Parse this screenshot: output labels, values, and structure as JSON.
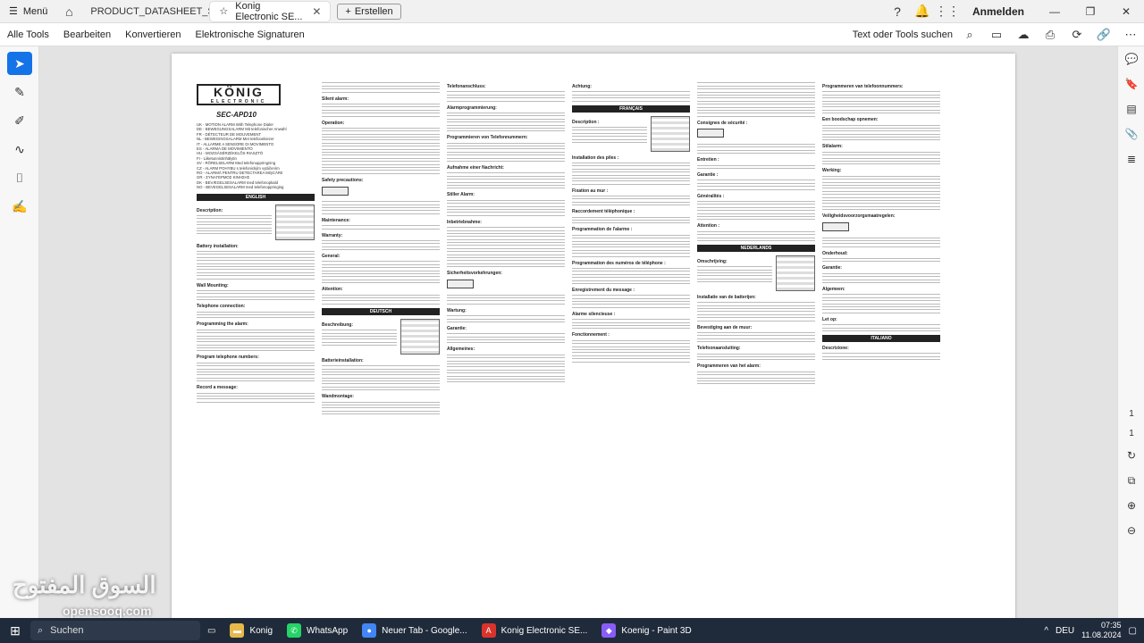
{
  "browser": {
    "menu_label": "Menü",
    "tabs": [
      {
        "title": "PRODUCT_DATASHEET_S...",
        "active": false
      },
      {
        "title": "Konig Electronic SE...",
        "active": true
      }
    ],
    "new_tab_label": "Erstellen",
    "signin_label": "Anmelden"
  },
  "toolbar": {
    "menu": [
      "Alle Tools",
      "Bearbeiten",
      "Konvertieren",
      "Elektronische Signaturen"
    ],
    "search_label": "Text oder Tools suchen"
  },
  "document": {
    "logo": "KÖNIG",
    "logo_sub": "ELECTRONIC",
    "model": "SEC-APD10",
    "sections": [
      "ENGLISH",
      "DEUTSCH",
      "FRANÇAIS",
      "NEDERLANDS",
      "ITALIANO"
    ],
    "col1_lines": [
      "UK - MOTION ALARM With Telephone Dialer",
      "DE - BEWEGUNGSALARM Mit telefonischer Anwahl",
      "FR - DÉTECTEUR DE MOUVEMENT",
      "NL - BEWEGINGSALARM Met telefoonkiezer",
      "IT - ALLARME A SENSORE DI MOVIMENTO",
      "ES - ALARMA DE MOVIMIENTO",
      "HU - MOZGÁSÉRZÉKELŐS RIASZTÓ",
      "FI - Liiketunnistinhälytin",
      "SV - RÖRELSELARM Med telefonuppringning",
      "CZ - ALARM POHYBU s telefonickým vytáčením",
      "RO - ALARMĂ PENTRU DETECTAREA MIŞCĂRII",
      "GR - ΣΥΝΑΓΕΡΜΟΣ ΚΙΝΗΣΗΣ",
      "DK - BEVÆGELSESALARM med telefonopkald",
      "NO - BEVEGELSESALARM med telefonoppringing"
    ],
    "english_heads": [
      "Description:",
      "Battery installation:",
      "Wall Mounting:",
      "Telephone connection:",
      "Programming the alarm:",
      "Program telephone numbers:",
      "Record a message:"
    ],
    "col2_heads": [
      "Silent alarm:",
      "Operation:",
      "Safety precautions:",
      "Maintenance:",
      "Warranty:",
      "General:",
      "Attention:"
    ],
    "deutsch_heads": [
      "Beschreibung:",
      "Batterieinstallation:",
      "Wandmontage:"
    ],
    "col3_heads": [
      "Telefonanschluss:",
      "Alarmprogrammierung:",
      "Programmieren von Telefonnummern:",
      "Aufnahme einer Nachricht:",
      "Stiller Alarm:",
      "Inbetriebnahme:",
      "Sicherheitsvorkehrungen:",
      "Wartung:",
      "Garantie:",
      "Allgemeines:"
    ],
    "col4_heads": [
      "Achtung:",
      "Description :",
      "Installation des piles :",
      "Fixation au mur :",
      "Raccordement téléphonique :",
      "Programmation de l'alarme :",
      "Programmation des numéros de téléphone :",
      "Enregistrement du message :",
      "Alarme silencieuse :",
      "Fonctionnement :"
    ],
    "col5_heads": [
      "Consignes de sécurité :",
      "Entretien :",
      "Garantie :",
      "Généralités :",
      "Attention :",
      "Omschrijving:",
      "Installatie van de batterijen:",
      "Bevestiging aan de muur:",
      "Telefoonaansluiting:",
      "Programmeren van het alarm:"
    ],
    "col6_heads": [
      "Programmeren van telefoonnummers:",
      "Een boodschap opnemen:",
      "Stilalarm:",
      "Werking:",
      "Veiligheidsvoorzorgsmaatregelen:",
      "Onderhoud:",
      "Garantie:",
      "Algemeen:",
      "Let op:",
      "Descrizione:"
    ]
  },
  "rightpanel": {
    "page_current": "1",
    "page_total": "1"
  },
  "watermark": {
    "main": "السوق المفتوح",
    "sub": "opensooq.com"
  },
  "taskbar": {
    "search_label": "Suchen",
    "apps": [
      {
        "label": "Konig",
        "color": "#e8b84a"
      },
      {
        "label": "WhatsApp",
        "color": "#25d366"
      },
      {
        "label": "Neuer Tab - Google...",
        "color": "#4285f4"
      },
      {
        "label": "Konig Electronic SE...",
        "color": "#d9342b"
      },
      {
        "label": "Koenig - Paint 3D",
        "color": "#8a5cf6"
      }
    ],
    "language": "DEU",
    "time": "07:35",
    "date": "11.08.2024"
  }
}
